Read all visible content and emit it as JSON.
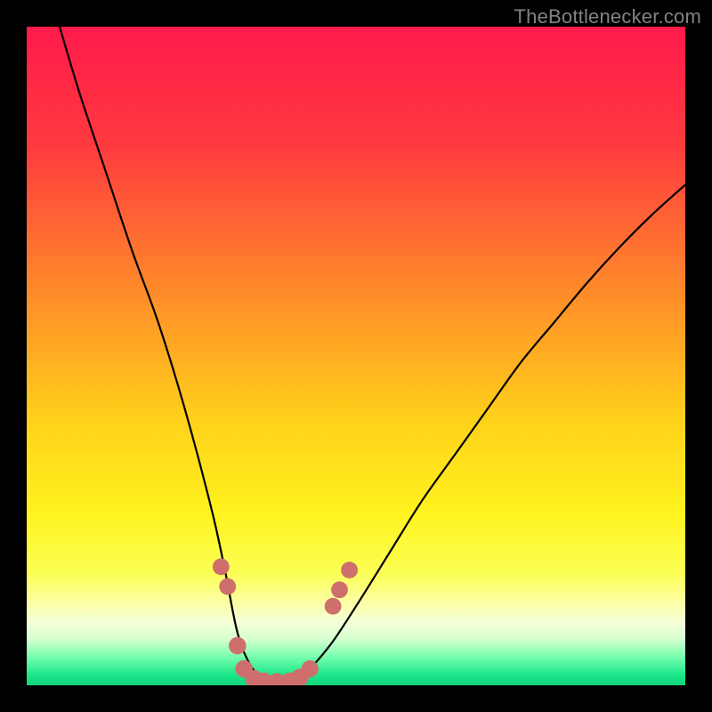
{
  "watermark": "TheBottlenecker.com",
  "gradient_stops": [
    {
      "offset": 0,
      "color": "#ff1a4b"
    },
    {
      "offset": 0.18,
      "color": "#ff3a3f"
    },
    {
      "offset": 0.4,
      "color": "#ff8a2a"
    },
    {
      "offset": 0.6,
      "color": "#ffd21a"
    },
    {
      "offset": 0.74,
      "color": "#fff31e"
    },
    {
      "offset": 0.83,
      "color": "#fbff55"
    },
    {
      "offset": 0.875,
      "color": "#fcffa6"
    },
    {
      "offset": 0.905,
      "color": "#f3ffd9"
    },
    {
      "offset": 0.93,
      "color": "#d6ffcf"
    },
    {
      "offset": 0.955,
      "color": "#7dffb0"
    },
    {
      "offset": 0.985,
      "color": "#19e689"
    },
    {
      "offset": 1.0,
      "color": "#12d47d"
    }
  ],
  "chart_data": {
    "type": "line",
    "title": "",
    "xlabel": "",
    "ylabel": "",
    "xlim": [
      0,
      100
    ],
    "ylim": [
      0,
      100
    ],
    "series": [
      {
        "name": "bottleneck-curve",
        "x": [
          5,
          8,
          12,
          16,
          20,
          24,
          28,
          30,
          32,
          34,
          36,
          38,
          40,
          42,
          46,
          50,
          55,
          60,
          65,
          70,
          75,
          80,
          85,
          90,
          95,
          100
        ],
        "y": [
          100,
          90,
          78,
          66,
          55,
          42,
          27,
          18,
          8,
          3,
          1,
          0.5,
          0.5,
          1.5,
          6,
          12,
          20,
          28,
          35,
          42,
          49,
          55,
          61,
          66.5,
          71.5,
          76
        ]
      }
    ],
    "markers": {
      "name": "salmon-dots",
      "color": "#cf6f6d",
      "points": [
        {
          "x": 29.5,
          "y": 18,
          "r": 1.2
        },
        {
          "x": 30.5,
          "y": 15,
          "r": 1.2
        },
        {
          "x": 32,
          "y": 6,
          "r": 1.4
        },
        {
          "x": 33,
          "y": 2.5,
          "r": 1.4
        },
        {
          "x": 34.5,
          "y": 1,
          "r": 1.4
        },
        {
          "x": 36,
          "y": 0.6,
          "r": 1.5
        },
        {
          "x": 38,
          "y": 0.5,
          "r": 1.5
        },
        {
          "x": 40,
          "y": 0.6,
          "r": 1.5
        },
        {
          "x": 41.5,
          "y": 1.2,
          "r": 1.4
        },
        {
          "x": 43,
          "y": 2.5,
          "r": 1.3
        },
        {
          "x": 46.5,
          "y": 12,
          "r": 1.2
        },
        {
          "x": 47.5,
          "y": 14.5,
          "r": 1.2
        },
        {
          "x": 49,
          "y": 17.5,
          "r": 1.2
        }
      ]
    }
  }
}
